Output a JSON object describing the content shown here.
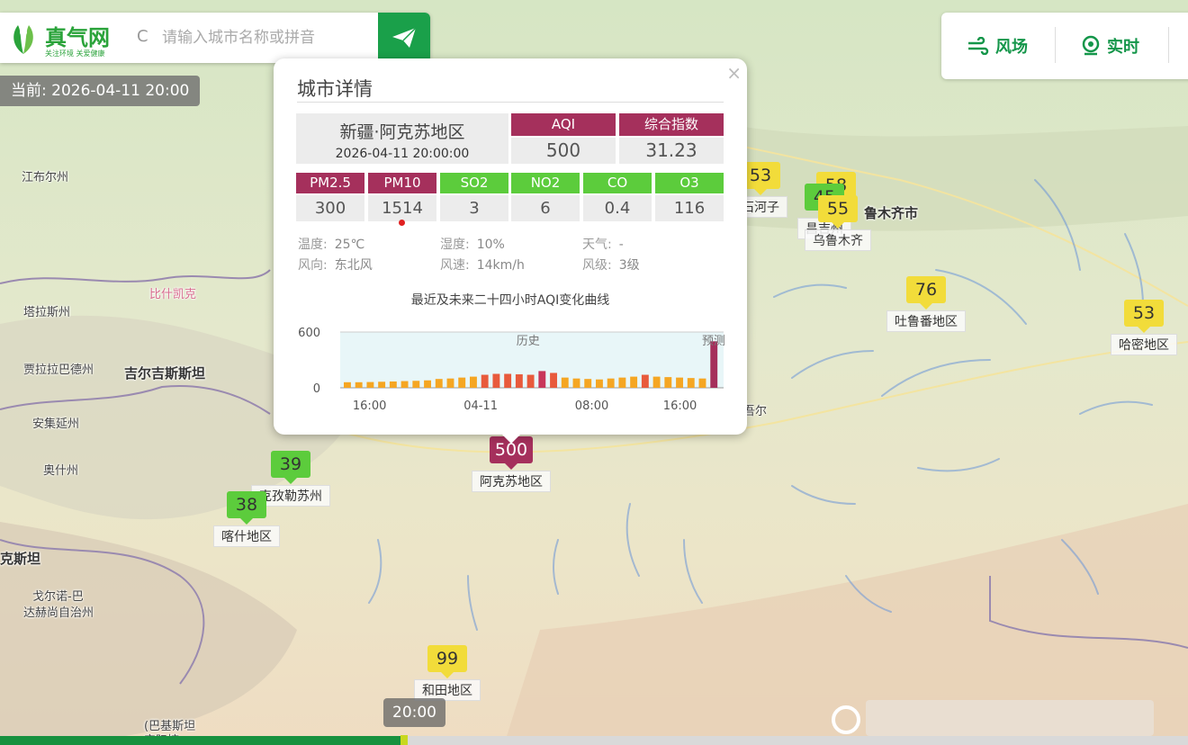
{
  "search": {
    "logo_text": "真气网",
    "logo_slogan": "关注环境 关爱健康",
    "placeholder": "请输入城市名称或拼音",
    "icon_c": "C"
  },
  "current_time": "当前: 2026-04-11 20:00",
  "toolbar": {
    "wind_label": "风场",
    "realtime_label": "实时"
  },
  "map_labels": [
    {
      "text": "江布尔州",
      "cls": ""
    },
    {
      "text": "比什凯克",
      "cls": "pink"
    },
    {
      "text": "塔拉斯州",
      "cls": ""
    },
    {
      "text": "贾拉拉巴德州",
      "cls": ""
    },
    {
      "text": "吉尔吉斯斯坦",
      "cls": "bold"
    },
    {
      "text": "安集延州",
      "cls": ""
    },
    {
      "text": "奥什州",
      "cls": ""
    },
    {
      "text": "克斯坦",
      "cls": "bold"
    },
    {
      "text": "戈尔诺-巴",
      "cls": ""
    },
    {
      "text": "达赫尚自治州",
      "cls": ""
    },
    {
      "text": "(巴基斯坦",
      "cls": ""
    },
    {
      "text": "实际控",
      "cls": ""
    },
    {
      "text": "鲁木齐市",
      "cls": "bold"
    },
    {
      "text": "吾尔",
      "cls": ""
    }
  ],
  "markers": [
    {
      "value": "53",
      "name": "石河子",
      "color": "#f2dc3a"
    },
    {
      "value": "58",
      "name": "",
      "color": "#f2dc3a"
    },
    {
      "value": "45",
      "name": "昌吉州",
      "color": "#5ccc3c"
    },
    {
      "value": "55",
      "name": "乌鲁木齐",
      "color": "#f2dc3a"
    },
    {
      "value": "76",
      "name": "吐鲁番地区",
      "color": "#f2dc3a"
    },
    {
      "value": "53",
      "name": "哈密地区",
      "color": "#f2dc3a"
    },
    {
      "value": "39",
      "name": "克孜勒苏州",
      "color": "#5ccc3c"
    },
    {
      "value": "38",
      "name": "喀什地区",
      "color": "#5ccc3c"
    },
    {
      "value": "500",
      "name": "阿克苏地区",
      "color": "#a5305c"
    },
    {
      "value": "99",
      "name": "和田地区",
      "color": "#f2dc3a"
    }
  ],
  "popup": {
    "title": "城市详情",
    "close": "×",
    "city": "新疆·阿克苏地区",
    "time": "2026-04-11 20:00:00",
    "aqi_label": "AQI",
    "aqi_value": "500",
    "index_label": "综合指数",
    "index_value": "31.23",
    "pollutants": [
      {
        "label": "PM2.5",
        "value": "300",
        "color": "#a5305c"
      },
      {
        "label": "PM10",
        "value": "1514",
        "color": "#a5305c"
      },
      {
        "label": "SO2",
        "value": "3",
        "color": "#5ccc3c"
      },
      {
        "label": "NO2",
        "value": "6",
        "color": "#5ccc3c"
      },
      {
        "label": "CO",
        "value": "0.4",
        "color": "#5ccc3c"
      },
      {
        "label": "O3",
        "value": "116",
        "color": "#5ccc3c"
      }
    ],
    "weather": {
      "temp_label": "温度:",
      "temp": "25℃",
      "humidity_label": "湿度:",
      "humidity": "10%",
      "weather_label": "天气:",
      "weather": "-",
      "wind_dir_label": "风向:",
      "wind_dir": "东北风",
      "wind_speed_label": "风速:",
      "wind_speed": "14km/h",
      "wind_level_label": "风级:",
      "wind_level": "3级"
    },
    "chart_title": "最近及未来二十四小时AQI变化曲线"
  },
  "chart_data": {
    "type": "bar",
    "title": "最近及未来二十四小时AQI变化曲线",
    "ylim": [
      0,
      600
    ],
    "yticks": [
      "600",
      "0"
    ],
    "xticks": [
      "16:00",
      "04-11",
      "08:00",
      "16:00"
    ],
    "region_labels": [
      "历史",
      "预测"
    ],
    "values": [
      60,
      60,
      62,
      65,
      68,
      72,
      75,
      80,
      95,
      100,
      110,
      120,
      140,
      150,
      150,
      145,
      140,
      180,
      160,
      110,
      100,
      95,
      90,
      100,
      110,
      120,
      140,
      120,
      115,
      110,
      105,
      100,
      500
    ],
    "colors": [
      "#f5a623",
      "#f5a623",
      "#f5a623",
      "#f5a623",
      "#f5a623",
      "#f5a623",
      "#f5a623",
      "#f5a623",
      "#f5a623",
      "#f5a623",
      "#f5a623",
      "#f5a623",
      "#e85a3c",
      "#e85a3c",
      "#e85a3c",
      "#e85a3c",
      "#e85a3c",
      "#c8365a",
      "#e85a3c",
      "#f5a623",
      "#f5a623",
      "#f5a623",
      "#f5a623",
      "#f5a623",
      "#f5a623",
      "#f5a623",
      "#e85a3c",
      "#f5a623",
      "#f5a623",
      "#f5a623",
      "#f5a623",
      "#f5a623",
      "#a5305c"
    ]
  },
  "timebar": {
    "label": "20:00",
    "progress": 0.34
  }
}
